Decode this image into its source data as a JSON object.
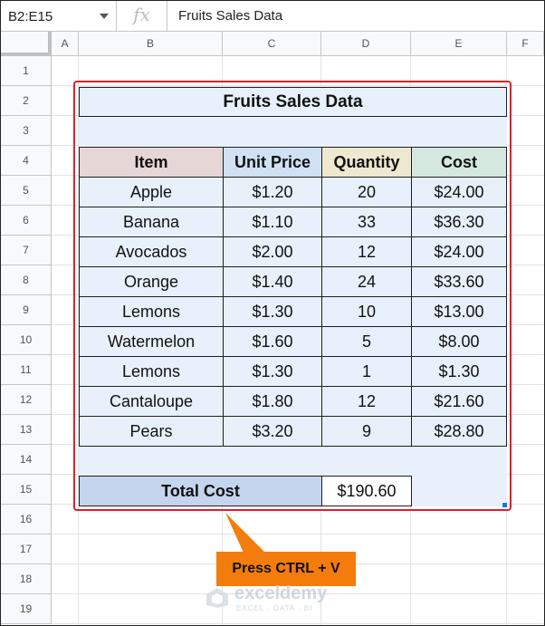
{
  "formula_bar": {
    "name_box": "B2:E15",
    "fx_label": "fx",
    "content": "Fruits Sales Data"
  },
  "columns": [
    "A",
    "B",
    "C",
    "D",
    "E",
    "F"
  ],
  "rows": [
    "1",
    "2",
    "3",
    "4",
    "5",
    "6",
    "7",
    "8",
    "9",
    "10",
    "11",
    "12",
    "13",
    "14",
    "15",
    "16",
    "17",
    "18",
    "19"
  ],
  "table": {
    "title": "Fruits Sales Data",
    "headers": {
      "item": "Item",
      "unit_price": "Unit Price",
      "quantity": "Quantity",
      "cost": "Cost"
    },
    "header_colors": {
      "item": "#e6d6d6",
      "unit_price": "#cfe1f3",
      "quantity": "#ede8cf",
      "cost": "#d4e8df"
    },
    "data": [
      {
        "item": "Apple",
        "unit_price": "$1.20",
        "quantity": "20",
        "cost": "$24.00"
      },
      {
        "item": "Banana",
        "unit_price": "$1.10",
        "quantity": "33",
        "cost": "$36.30"
      },
      {
        "item": "Avocados",
        "unit_price": "$2.00",
        "quantity": "12",
        "cost": "$24.00"
      },
      {
        "item": "Orange",
        "unit_price": "$1.40",
        "quantity": "24",
        "cost": "$33.60"
      },
      {
        "item": "Lemons",
        "unit_price": "$1.30",
        "quantity": "10",
        "cost": "$13.00"
      },
      {
        "item": "Watermelon",
        "unit_price": "$1.60",
        "quantity": "5",
        "cost": "$8.00"
      },
      {
        "item": "Lemons",
        "unit_price": "$1.30",
        "quantity": "1",
        "cost": "$1.30"
      },
      {
        "item": "Cantaloupe",
        "unit_price": "$1.80",
        "quantity": "12",
        "cost": "$21.60"
      },
      {
        "item": "Pears",
        "unit_price": "$3.20",
        "quantity": "9",
        "cost": "$28.80"
      }
    ],
    "total_label": "Total Cost",
    "total_value": "$190.60"
  },
  "callout": {
    "text": "Press CTRL + V",
    "color": "#f47c0c"
  },
  "watermark": {
    "name": "exceldemy",
    "tagline": "EXCEL · DATA · BI"
  },
  "colors": {
    "selection": "#e01f26",
    "table_fill": "#e8f1fb",
    "total_fill": "#c5d5ee"
  }
}
